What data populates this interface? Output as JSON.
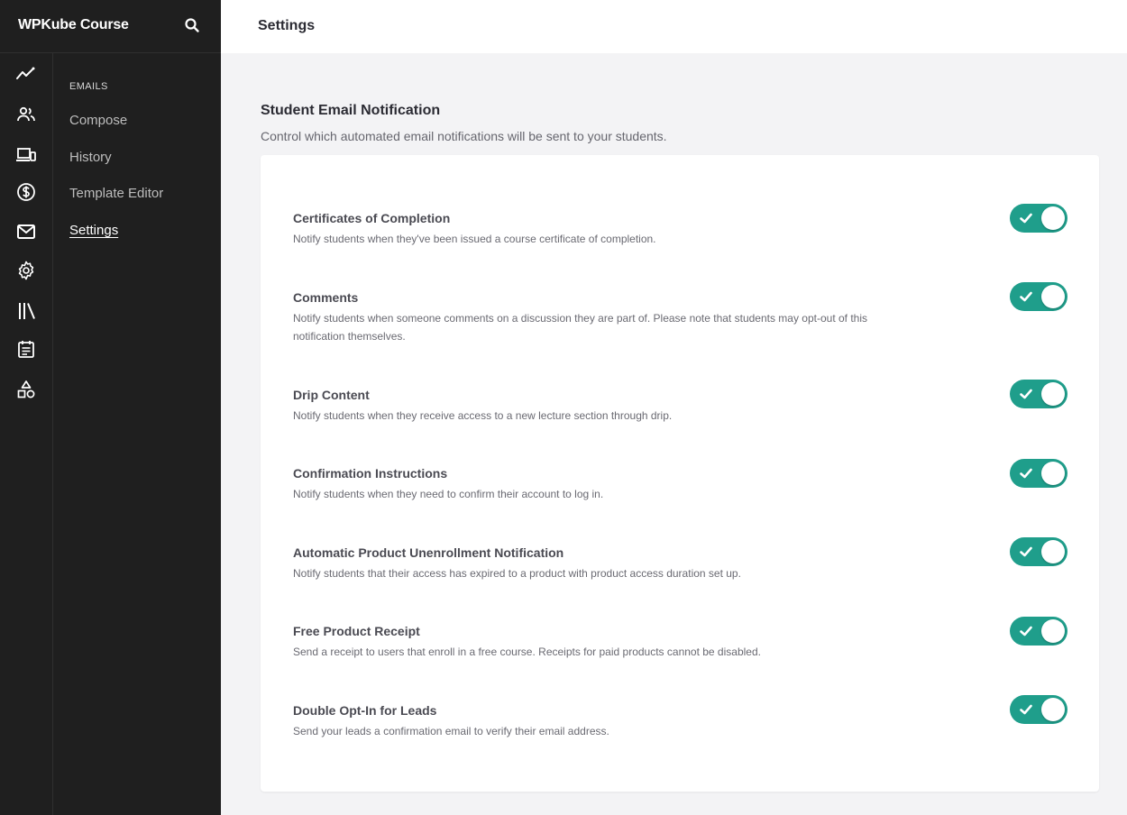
{
  "app": {
    "brand": "WPKube Course"
  },
  "rail_icons": [
    "analytics-icon",
    "users-icon",
    "devices-icon",
    "dollar-icon",
    "mail-icon",
    "gear-icon",
    "library-icon",
    "calendar-icon",
    "shapes-icon"
  ],
  "subnav": {
    "heading": "EMAILS",
    "items": [
      {
        "label": "Compose",
        "active": false
      },
      {
        "label": "History",
        "active": false
      },
      {
        "label": "Template Editor",
        "active": false
      },
      {
        "label": "Settings",
        "active": true
      }
    ]
  },
  "header": {
    "title": "Settings"
  },
  "main": {
    "section_title": "Student Email Notification",
    "section_desc": "Control which automated email notifications will be sent to your students.",
    "notifications": [
      {
        "title": "Certificates of Completion",
        "desc": "Notify students when they've been issued a course certificate of completion.",
        "enabled": true
      },
      {
        "title": "Comments",
        "desc": "Notify students when someone comments on a discussion they are part of. Please note that students may opt-out of this notification themselves.",
        "enabled": true
      },
      {
        "title": "Drip Content",
        "desc": "Notify students when they receive access to a new lecture section through drip.",
        "enabled": true
      },
      {
        "title": "Confirmation Instructions",
        "desc": "Notify students when they need to confirm their account to log in.",
        "enabled": true
      },
      {
        "title": "Automatic Product Unenrollment Notification",
        "desc": "Notify students that their access has expired to a product with product access duration set up.",
        "enabled": true
      },
      {
        "title": "Free Product Receipt",
        "desc": "Send a receipt to users that enroll in a free course. Receipts for paid products cannot be disabled.",
        "enabled": true
      },
      {
        "title": "Double Opt-In for Leads",
        "desc": "Send your leads a confirmation email to verify their email address.",
        "enabled": true
      }
    ]
  },
  "colors": {
    "sidebar_bg": "#1f1f1f",
    "toggle_on": "#1f9e8b",
    "page_bg": "#f3f3f5"
  }
}
